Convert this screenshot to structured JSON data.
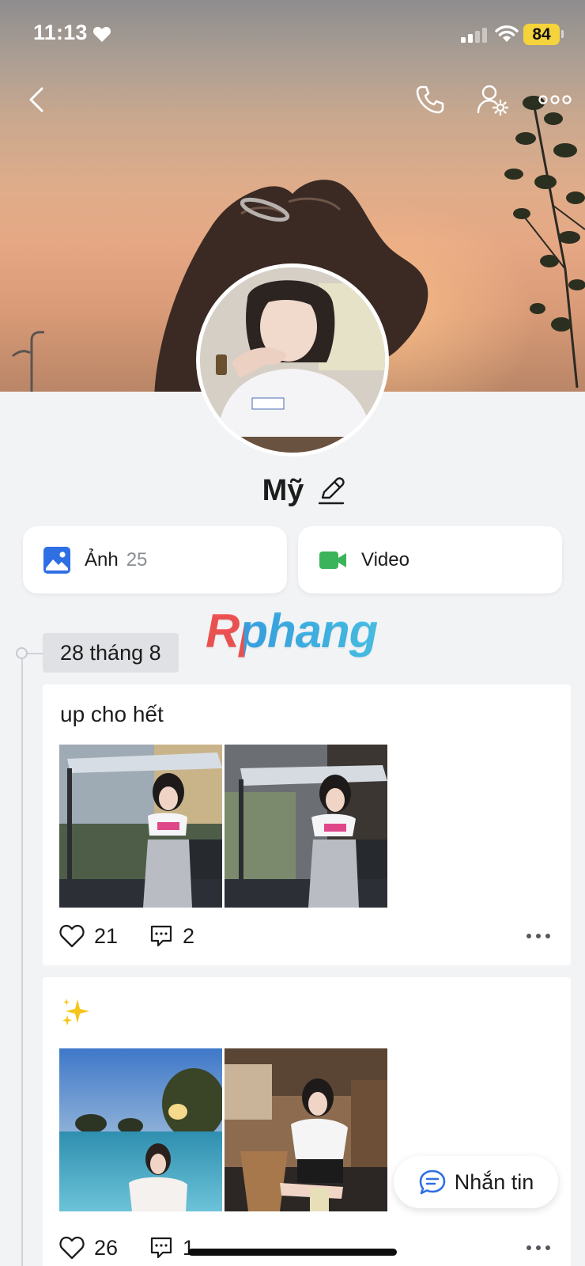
{
  "status_bar": {
    "time": "11:13",
    "battery": "84"
  },
  "nav": {
    "back_icon": "chevron-left-icon",
    "call_icon": "phone-icon",
    "settings_icon": "user-settings-icon",
    "more_icon": "more-horizontal-icon"
  },
  "profile": {
    "name": "Mỹ",
    "edit_icon": "pencil-icon"
  },
  "media_tabs": {
    "photos_label": "Ảnh",
    "photos_count": "25",
    "video_label": "Video"
  },
  "watermark": "Rphang",
  "timeline": {
    "date_label": "28 tháng 8",
    "posts": [
      {
        "caption": "up cho hết",
        "likes": "21",
        "comments": "2"
      },
      {
        "caption_emoji": "sparkles-icon",
        "likes": "26",
        "comments": "1"
      }
    ]
  },
  "message_button": {
    "label": "Nhắn tin"
  },
  "colors": {
    "accent_blue": "#2f6fe4",
    "video_green": "#3bb35b",
    "battery_yellow": "#f5d33b",
    "background": "#f2f3f5"
  }
}
